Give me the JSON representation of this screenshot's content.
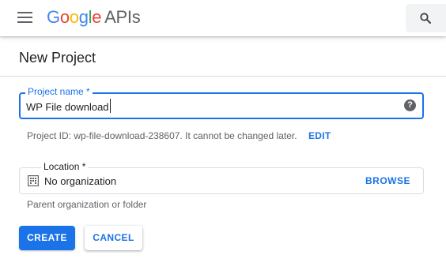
{
  "header": {
    "logo_letters": [
      "G",
      "o",
      "o",
      "g",
      "l",
      "e"
    ],
    "logo_suffix": "APIs",
    "menu_icon": "hamburger-menu-icon",
    "search_icon": "search-icon"
  },
  "page": {
    "title": "New Project"
  },
  "project_name": {
    "label": "Project name *",
    "value": "WP File download",
    "help_icon": "help-circle-icon",
    "help_glyph": "?"
  },
  "project_id": {
    "helper_text": "Project ID: wp-file-download-238607. It cannot be changed later.",
    "edit_label": "EDIT"
  },
  "location": {
    "label": "Location *",
    "value": "No organization",
    "icon": "building-icon",
    "browse_label": "BROWSE",
    "helper_text": "Parent organization or folder"
  },
  "actions": {
    "create_label": "CREATE",
    "cancel_label": "CANCEL"
  },
  "colors": {
    "accent": "#1a73e8",
    "google_blue": "#4285f4",
    "google_red": "#ea4335",
    "google_yellow": "#fbbc05",
    "google_green": "#34a853"
  }
}
